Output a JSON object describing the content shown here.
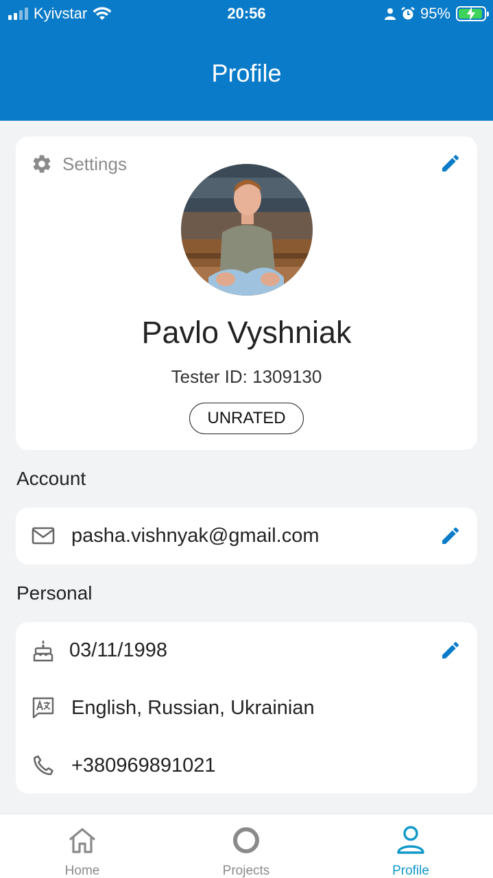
{
  "status_bar": {
    "carrier": "Kyivstar",
    "time": "20:56",
    "battery": "95%",
    "battery_level": 0.95
  },
  "header": {
    "title": "Profile"
  },
  "profile": {
    "settings_label": "Settings",
    "name": "Pavlo Vyshniak",
    "tester_id": "Tester ID: 1309130",
    "rating_badge": "UNRATED"
  },
  "account": {
    "section_title": "Account",
    "email": "pasha.vishnyak@gmail.com"
  },
  "personal": {
    "section_title": "Personal",
    "birthday": "03/11/1998",
    "languages": "English, Russian, Ukrainian",
    "phone": "+380969891021"
  },
  "tabs": [
    {
      "label": "Home",
      "icon": "home-icon",
      "active": false
    },
    {
      "label": "Projects",
      "icon": "projects-icon",
      "active": false
    },
    {
      "label": "Profile",
      "icon": "profile-icon",
      "active": true
    }
  ],
  "colors": {
    "header": "#0a7bc8",
    "accent": "#0a7bc8",
    "active_tab": "#1098c8",
    "background": "#f2f3f5"
  }
}
